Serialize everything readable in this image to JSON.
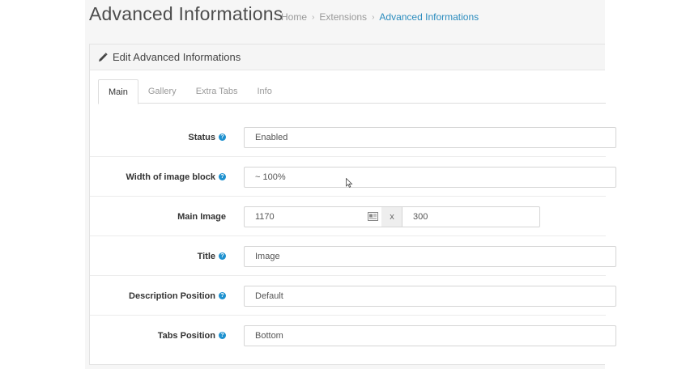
{
  "header": {
    "title": "Advanced Informations",
    "breadcrumb": [
      "Home",
      "Extensions",
      "Advanced Informations"
    ]
  },
  "panel": {
    "heading": "Edit Advanced Informations",
    "tabs": [
      "Main",
      "Gallery",
      "Extra Tabs",
      "Info"
    ],
    "active_tab": "Main"
  },
  "form": {
    "status": {
      "label": "Status",
      "value": "Enabled"
    },
    "width_block": {
      "label": "Width of image block",
      "value": "~ 100%"
    },
    "main_image": {
      "label": "Main Image",
      "width": "1170",
      "separator": "x",
      "height": "300"
    },
    "title": {
      "label": "Title",
      "value": "Image"
    },
    "description_position": {
      "label": "Description Position",
      "value": "Default"
    },
    "tabs_position": {
      "label": "Tabs Position",
      "value": "Bottom"
    }
  },
  "icons": {
    "help": "question-circle-icon",
    "heading": "pencil-icon",
    "size_field": "image-size-icon"
  },
  "colors": {
    "accent": "#1e91cf",
    "breadcrumb_active": "#2b8cbe"
  }
}
